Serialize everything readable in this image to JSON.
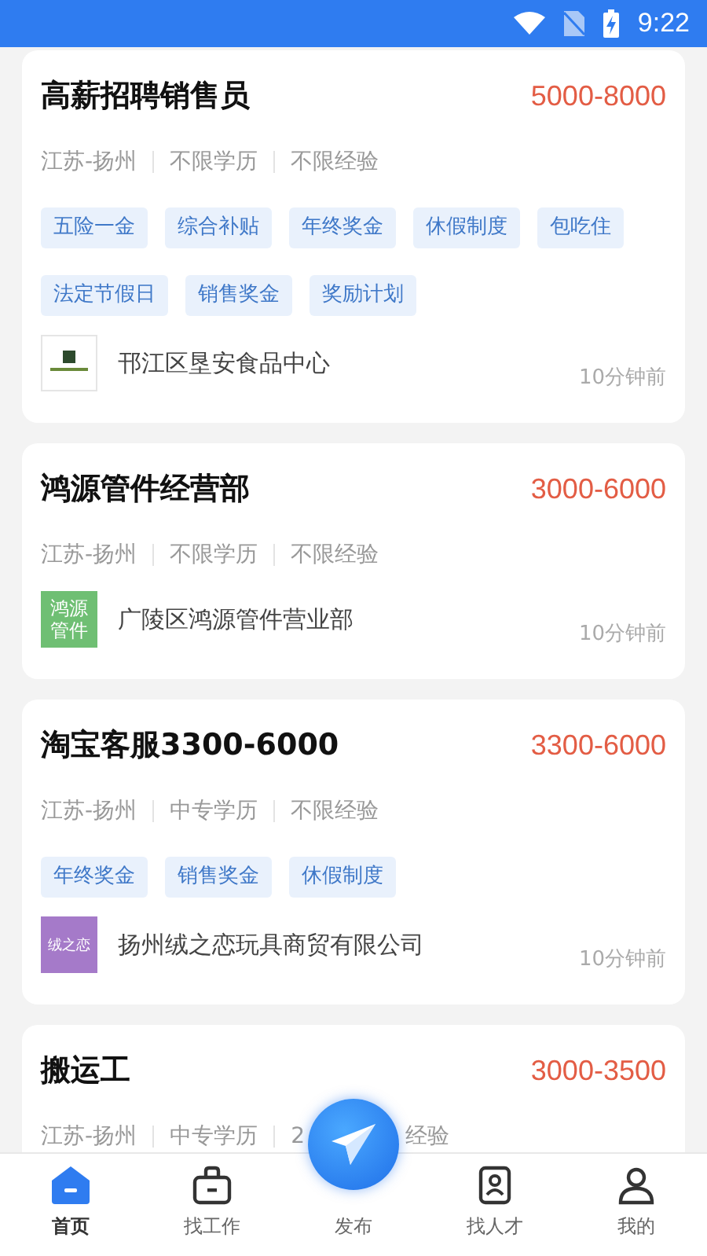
{
  "status_bar": {
    "time": "9:22"
  },
  "jobs": [
    {
      "title": "高薪招聘销售员",
      "salary": "5000-8000",
      "meta": [
        "江苏-扬州",
        "不限学历",
        "不限经验"
      ],
      "tags": [
        "五险一金",
        "综合补贴",
        "年终奖金",
        "休假制度",
        "包吃住",
        "法定节假日",
        "销售奖金",
        "奖励计划"
      ],
      "company": {
        "name": "邗江区垦安食品中心",
        "logo": {
          "kind": "image"
        }
      },
      "time": "10分钟前"
    },
    {
      "title": "鸿源管件经营部",
      "salary": "3000-6000",
      "meta": [
        "江苏-扬州",
        "不限学历",
        "不限经验"
      ],
      "company": {
        "name": "广陵区鸿源管件营业部",
        "logo": {
          "kind": "text",
          "text": "鸿源管件",
          "color": "#6fbf73"
        }
      },
      "time": "10分钟前"
    },
    {
      "title": "淘宝客服3300-6000",
      "salary": "3300-6000",
      "meta": [
        "江苏-扬州",
        "中专学历",
        "不限经验"
      ],
      "tags": [
        "年终奖金",
        "销售奖金",
        "休假制度"
      ],
      "company": {
        "name": "扬州绒之恋玩具商贸有限公司",
        "logo": {
          "kind": "text",
          "text": "绒之恋",
          "color": "#a57ac9"
        }
      },
      "time": "10分钟前"
    },
    {
      "title": "搬运工",
      "salary": "3000-3500",
      "meta": [
        "江苏-扬州",
        "中专学历",
        "2"
      ],
      "meta_tail": "经验"
    }
  ],
  "nav": [
    {
      "label": "首页",
      "selected": true
    },
    {
      "label": "找工作",
      "selected": false
    },
    {
      "label": "发布",
      "selected": false
    },
    {
      "label": "找人才",
      "selected": false
    },
    {
      "label": "我的",
      "selected": false
    }
  ]
}
